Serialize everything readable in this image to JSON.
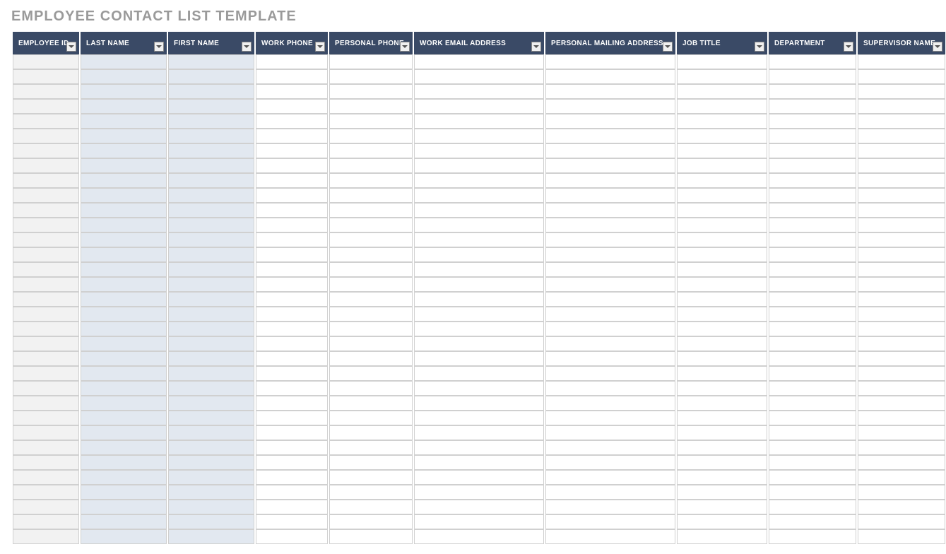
{
  "title": "EMPLOYEE CONTACT LIST TEMPLATE",
  "columns": [
    {
      "label": "EMPLOYEE ID",
      "shade": "grey"
    },
    {
      "label": "LAST NAME",
      "shade": "blue"
    },
    {
      "label": "FIRST NAME",
      "shade": "blue"
    },
    {
      "label": "WORK PHONE",
      "shade": "none"
    },
    {
      "label": "PERSONAL PHONE",
      "shade": "none"
    },
    {
      "label": "WORK EMAIL ADDRESS",
      "shade": "none"
    },
    {
      "label": "PERSONAL MAILING ADDRESS",
      "shade": "none"
    },
    {
      "label": "JOB TITLE",
      "shade": "none"
    },
    {
      "label": "DEPARTMENT",
      "shade": "none"
    },
    {
      "label": "SUPERVISOR NAME",
      "shade": "none"
    }
  ],
  "row_count": 33,
  "rows": []
}
